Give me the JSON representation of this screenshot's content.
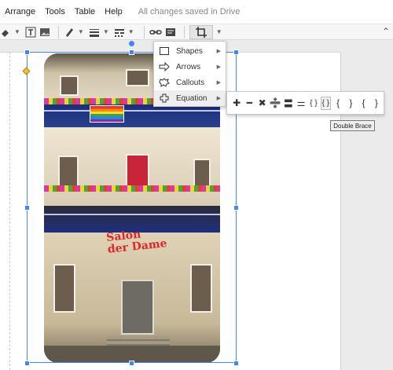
{
  "menubar": {
    "items": [
      "Arrange",
      "Tools",
      "Table",
      "Help"
    ],
    "status": "All changes saved in Drive"
  },
  "toolbar": {
    "icons": [
      "shape-fill-icon",
      "text-box-icon",
      "image-icon",
      "line-color-icon",
      "line-weight-icon",
      "line-dash-icon",
      "link-icon",
      "comment-icon",
      "crop-icon"
    ],
    "collapse": "⌃"
  },
  "menu": {
    "items": [
      {
        "label": "Shapes",
        "icon": "square-icon"
      },
      {
        "label": "Arrows",
        "icon": "arrow-icon"
      },
      {
        "label": "Callouts",
        "icon": "callout-icon"
      },
      {
        "label": "Equation",
        "icon": "plus-icon"
      }
    ],
    "submenu_arrow": "▶"
  },
  "equation_palette": {
    "symbols": [
      "✚",
      "━",
      "✖",
      "➗",
      "〓",
      "⚌",
      "{ }",
      "{ }",
      "{",
      "}",
      "{",
      "}"
    ],
    "selected_index": 7
  },
  "tooltip": {
    "text": "Double Brace"
  },
  "photo": {
    "sign_line1": "Salon",
    "sign_line2": "der Dame"
  },
  "colors": {
    "selection": "#4285f4",
    "handle_yellow": "#f2c230",
    "sign_red": "#e0282a"
  }
}
